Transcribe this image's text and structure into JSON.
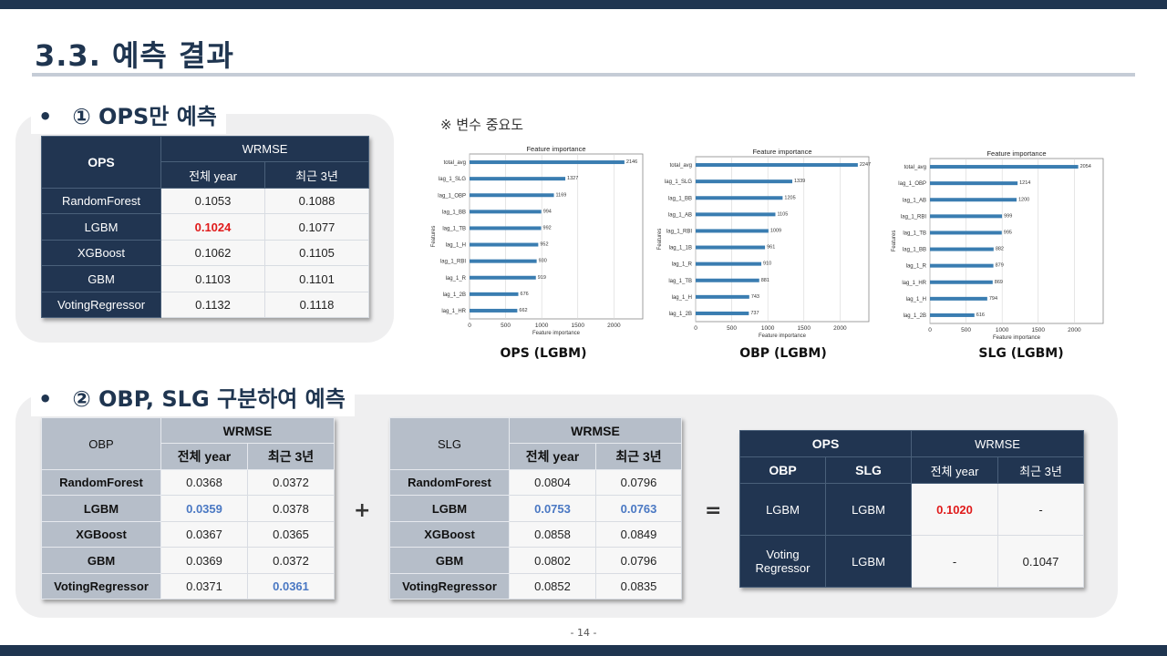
{
  "title": "3.3. 예측 결과",
  "section1": {
    "bullet": "•",
    "label": "① OPS만 예측",
    "table": {
      "corner": "OPS",
      "metric": "WRMSE",
      "col1": "전체 year",
      "col2": "최근 3년",
      "rows": [
        {
          "model": "RandomForest",
          "all": "0.1053",
          "recent": "0.1088"
        },
        {
          "model": "LGBM",
          "all": "0.1024",
          "recent": "0.1077"
        },
        {
          "model": "XGBoost",
          "all": "0.1062",
          "recent": "0.1105"
        },
        {
          "model": "GBM",
          "all": "0.1103",
          "recent": "0.1101"
        },
        {
          "model": "VotingRegressor",
          "all": "0.1132",
          "recent": "0.1118"
        }
      ]
    }
  },
  "importance": {
    "title": "※ 변수 중요도",
    "charts": [
      {
        "caption": "OPS (LGBM)",
        "plot_title": "Feature importance",
        "xlabel": "Feature importance",
        "ylabel": "Features",
        "features": [
          "total_avg",
          "lag_1_SLG",
          "lag_1_OBP",
          "lag_1_BB",
          "lag_1_TB",
          "lag_1_H",
          "lag_1_RBI",
          "lag_1_R",
          "lag_1_2B",
          "lag_1_HR"
        ],
        "values": [
          2146,
          1327,
          1169,
          994,
          992,
          952,
          930,
          919,
          676,
          662
        ]
      },
      {
        "caption": "OBP (LGBM)",
        "plot_title": "Feature importance",
        "xlabel": "Feature importance",
        "ylabel": "Features",
        "features": [
          "total_avg",
          "lag_1_SLG",
          "lag_1_BB",
          "lag_1_AB",
          "lag_1_RBI",
          "lag_1_1B",
          "lag_1_R",
          "lag_1_TB",
          "lag_1_H",
          "lag_1_2B"
        ],
        "values": [
          2247,
          1339,
          1205,
          1105,
          1009,
          961,
          910,
          881,
          743,
          737
        ]
      },
      {
        "caption": "SLG (LGBM)",
        "plot_title": "Feature importance",
        "xlabel": "Feature importance",
        "ylabel": "Features",
        "features": [
          "total_avg",
          "lag_1_OBP",
          "lag_1_AB",
          "lag_1_RBI",
          "lag_1_TB",
          "lag_1_BB",
          "lag_1_R",
          "lag_1_HR",
          "lag_1_H",
          "lag_1_2B"
        ],
        "values": [
          2054,
          1214,
          1200,
          999,
          995,
          882,
          879,
          869,
          794,
          616
        ]
      }
    ],
    "xticks": [
      "0",
      "500",
      "1000",
      "1500",
      "2000"
    ]
  },
  "section2": {
    "bullet": "•",
    "label": "② OBP, SLG 구분하여 예측",
    "obp": {
      "corner": "OBP",
      "metric": "WRMSE",
      "col1": "전체 year",
      "col2": "최근 3년",
      "rows": [
        {
          "model": "RandomForest",
          "all": "0.0368",
          "recent": "0.0372"
        },
        {
          "model": "LGBM",
          "all": "0.0359",
          "recent": "0.0378"
        },
        {
          "model": "XGBoost",
          "all": "0.0367",
          "recent": "0.0365"
        },
        {
          "model": "GBM",
          "all": "0.0369",
          "recent": "0.0372"
        },
        {
          "model": "VotingRegressor",
          "all": "0.0371",
          "recent": "0.0361"
        }
      ]
    },
    "slg": {
      "corner": "SLG",
      "metric": "WRMSE",
      "col1": "전체 year",
      "col2": "최근 3년",
      "rows": [
        {
          "model": "RandomForest",
          "all": "0.0804",
          "recent": "0.0796"
        },
        {
          "model": "LGBM",
          "all": "0.0753",
          "recent": "0.0763"
        },
        {
          "model": "XGBoost",
          "all": "0.0858",
          "recent": "0.0849"
        },
        {
          "model": "GBM",
          "all": "0.0802",
          "recent": "0.0796"
        },
        {
          "model": "VotingRegressor",
          "all": "0.0852",
          "recent": "0.0835"
        }
      ]
    },
    "plus": "+",
    "equals": "=",
    "result": {
      "ops": "OPS",
      "metric": "WRMSE",
      "obp": "OBP",
      "slg": "SLG",
      "col1": "전체 year",
      "col2": "최근 3년",
      "rows": [
        {
          "obp": "LGBM",
          "slg": "LGBM",
          "all": "0.1020",
          "recent": "-"
        },
        {
          "obp": "Voting Regressor",
          "slg": "LGBM",
          "all": "-",
          "recent": "0.1047"
        }
      ]
    }
  },
  "page_number": "- 14 -",
  "colors": {
    "navy": "#1f3550",
    "highlight_red": "#e01b1b",
    "highlight_blue": "#4a78c3",
    "bar": "#3a7db1"
  }
}
